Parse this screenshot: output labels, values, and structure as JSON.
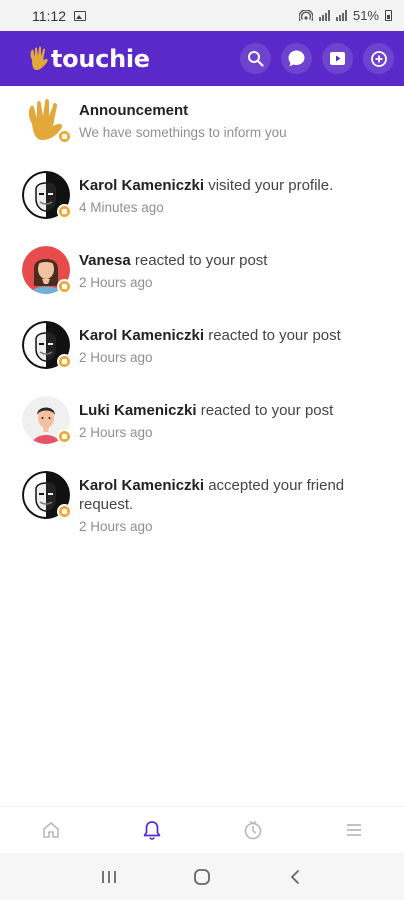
{
  "status_bar": {
    "time": "11:12",
    "battery": "51%"
  },
  "app": {
    "name": "touchie"
  },
  "notifications": [
    {
      "name": "Announcement",
      "action": "",
      "time": "We have somethings to inform you",
      "avatar": "hand-logo"
    },
    {
      "name": "Karol Kameniczki",
      "action": " visited your profile.",
      "time": "4 Minutes ago",
      "avatar": "bw-portrait"
    },
    {
      "name": "Vanesa",
      "action": " reacted to your post",
      "time": "2 Hours ago",
      "avatar": "woman-red"
    },
    {
      "name": "Karol Kameniczki",
      "action": " reacted to your post",
      "time": "2 Hours ago",
      "avatar": "bw-portrait"
    },
    {
      "name": "Luki Kameniczki",
      "action": " reacted to your post",
      "time": "2 Hours ago",
      "avatar": "man-cartoon"
    },
    {
      "name": "Karol Kameniczki",
      "action": " accepted your friend request.",
      "time": "2 Hours ago",
      "avatar": "bw-portrait"
    }
  ],
  "bottom_nav": [
    {
      "icon": "home-icon",
      "active": false
    },
    {
      "icon": "bell-icon",
      "active": true
    },
    {
      "icon": "activity-icon",
      "active": false
    },
    {
      "icon": "menu-icon",
      "active": false
    }
  ],
  "colors": {
    "brand": "#5b29c9",
    "badge": "#f0a630",
    "active_tab": "#5b29c9",
    "inactive_tab": "#b8b8b8"
  }
}
